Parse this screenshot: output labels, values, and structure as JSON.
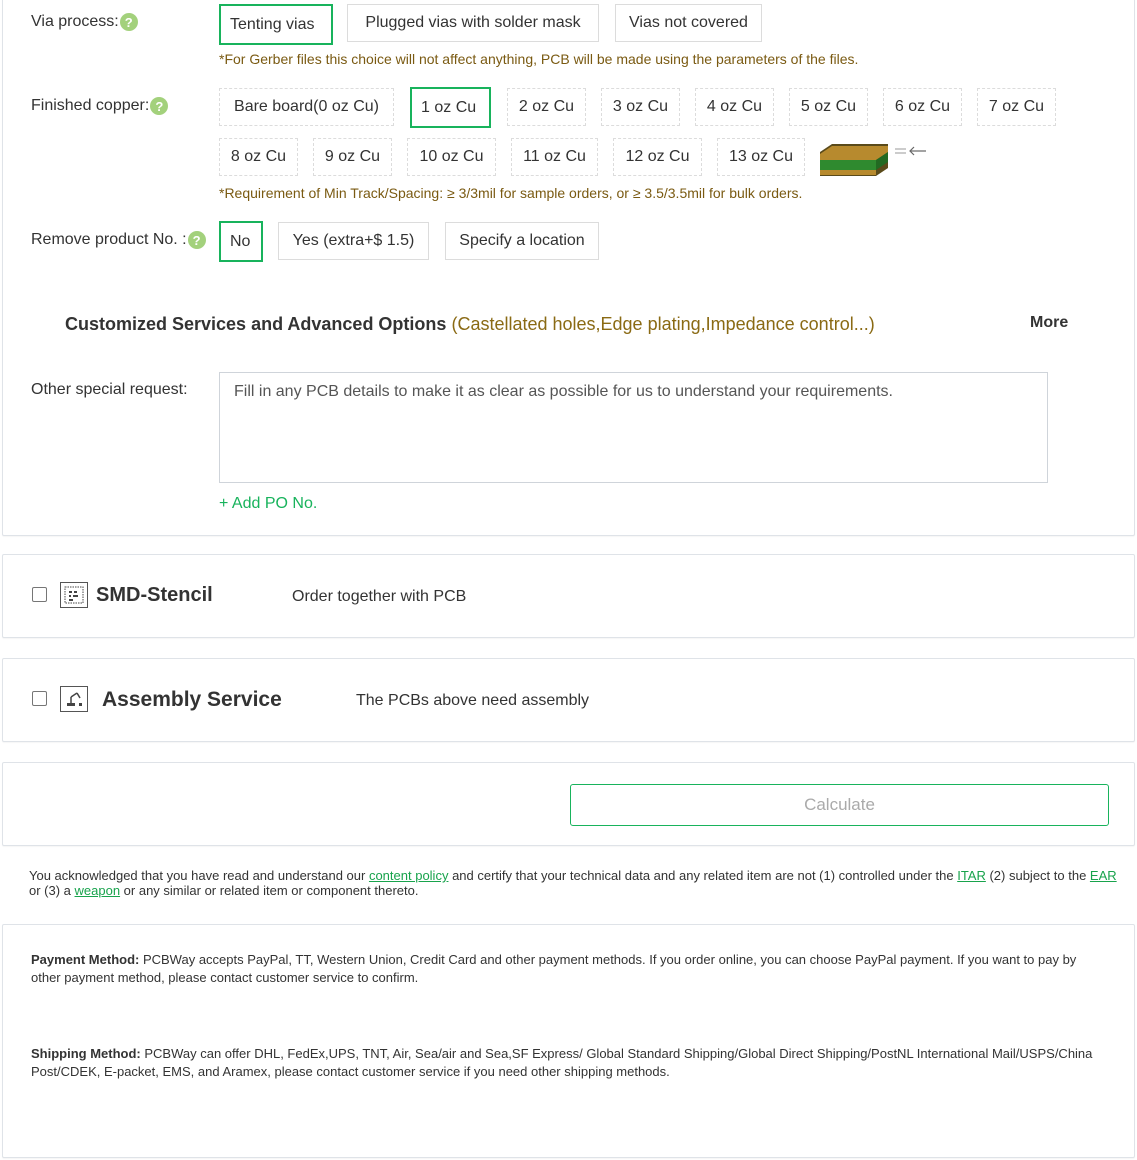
{
  "via": {
    "label": "Via process:",
    "options": [
      "Tenting vias",
      "Plugged vias with solder mask",
      "Vias not covered"
    ],
    "note": "*For Gerber files this choice will not affect anything, PCB will be made using the parameters of the files."
  },
  "copper": {
    "label": "Finished copper:",
    "row1": [
      "Bare board(0 oz Cu)",
      "1 oz Cu",
      "2 oz Cu",
      "3 oz Cu",
      "4 oz Cu",
      "5 oz Cu",
      "6 oz Cu",
      "7 oz Cu"
    ],
    "row2": [
      "8 oz Cu",
      "9 oz Cu",
      "10 oz Cu",
      "11 oz Cu",
      "12 oz Cu",
      "13 oz Cu"
    ],
    "note": "*Requirement of Min Track/Spacing: ≥ 3/3mil for sample orders, or ≥ 3.5/3.5mil for bulk orders."
  },
  "remove": {
    "label": "Remove product No. :",
    "options": [
      "No",
      "Yes (extra+$ 1.5)",
      "Specify a location"
    ]
  },
  "custom": {
    "title": "Customized Services and Advanced Options",
    "sub": "(Castellated holes,Edge plating,Impedance control...)",
    "more": "More"
  },
  "special": {
    "label": "Other special request:",
    "placeholder": "Fill in any PCB details to make it as clear as possible for us to understand your requirements.",
    "add_po": "+ Add PO No."
  },
  "smd": {
    "title": "SMD-Stencil",
    "sub": "Order together with PCB"
  },
  "assembly": {
    "title": "Assembly Service",
    "sub": "The PCBs above need assembly"
  },
  "calculate": "Calculate",
  "ack": {
    "t1": "You acknowledged that you have read and understand our ",
    "link1": "content policy",
    "t2": " and certify that your technical data and any related item are not (1) controlled under the ",
    "link2": "ITAR",
    "t3": " (2) subject to the ",
    "link3": "EAR",
    "t4": " or (3) a ",
    "link4": "weapon",
    "t5": " or any similar or related item or component thereto."
  },
  "payment": {
    "label": "Payment Method:",
    "text": " PCBWay accepts PayPal, TT, Western Union, Credit Card and other payment methods. If you order online, you can choose PayPal payment. If you want to pay by other payment method, please contact customer service to confirm."
  },
  "shipping": {
    "label": "Shipping Method:",
    "text": " PCBWay can offer DHL, FedEx,UPS, TNT, Air, Sea/air and Sea,SF Express/ Global Standard Shipping/Global Direct Shipping/PostNL International Mail/USPS/China Post/CDEK, E-packet, EMS, and Aramex, please contact customer service if you need other shipping methods."
  },
  "colors": {
    "accent": "#18b35c",
    "note": "#7a5a12",
    "help": "#a3d17c"
  },
  "icons": {
    "help": "question-circle-icon",
    "smd": "stencil-icon",
    "assembly": "assembly-robot-icon",
    "board": "pcb-board-icon",
    "arrow": "arrow-left-icon"
  }
}
